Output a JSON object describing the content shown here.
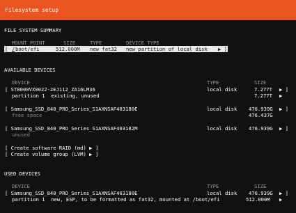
{
  "title": "Filesystem setup",
  "summary": {
    "heading": "FILE SYSTEM SUMMARY",
    "columns": [
      "MOUNT POINT",
      "SIZE",
      "TYPE",
      "DEVICE TYPE"
    ],
    "row": {
      "open_bracket": "[",
      "mount_first": "/",
      "mount_rest": "boot/efi",
      "size": "512.000M",
      "type": "new fat32",
      "device_type": "new partition of local disk",
      "arrow": "▶ ]"
    }
  },
  "available": {
    "heading": "AVAILABLE DEVICES",
    "columns": {
      "device": "DEVICE",
      "type": "TYPE",
      "size": "SIZE"
    },
    "devices": [
      {
        "name": "[ ST8000VX0022-2EJ112_ZA16LM36",
        "type": "local disk",
        "size": "7.277T",
        "arrow": "▶ ]",
        "sub_name": "partition 1  existing, unused",
        "sub_size": "7.277T",
        "sub_arrow": "▶"
      },
      {
        "name": "[ Samsung_SSD_840_PRO_Series_S1AXNSAF403180E",
        "type": "local disk",
        "size": "476.939G",
        "arrow": "▶ ]",
        "sub_name": "free space",
        "sub_size": "476.437G"
      },
      {
        "name": "[ Samsung_SSD_840_PRO_Series_S1AXNSAF403182M",
        "type": "local disk",
        "size": "476.939G",
        "arrow": "▶ ]",
        "sub_name": "unused"
      }
    ],
    "actions": [
      "[ Create software RAID (md) ▶ ]",
      "[ Create volume group (LVM) ▶ ]"
    ]
  },
  "used": {
    "heading": "USED DEVICES",
    "columns": {
      "device": "DEVICE",
      "type": "TYPE",
      "size": "SIZE"
    },
    "device": {
      "name": "[ Samsung_SSD_840_PRO_Series_S1AXNSAF403180E",
      "type": "local disk",
      "size": "476.939G",
      "arrow": "▶ ]",
      "sub_name": "partition 1  new, ESP, to be formatted as fat32, mounted at /boot/efi",
      "sub_size": "512.000M",
      "sub_arrow": "▶"
    }
  }
}
